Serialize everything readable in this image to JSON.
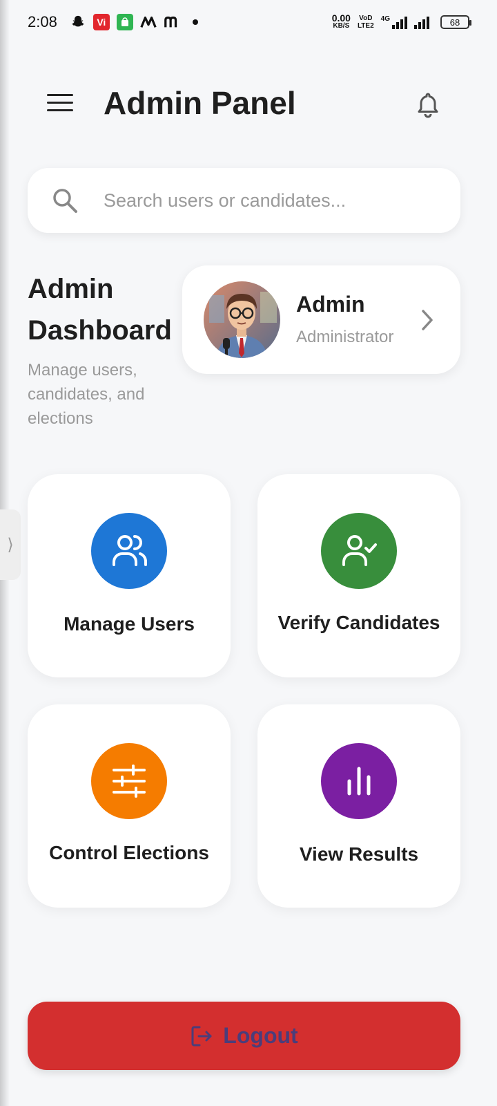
{
  "status_bar": {
    "time": "2:08",
    "net_speed_value": "0.00",
    "net_speed_unit": "KB/S",
    "volte_top": "VoD",
    "volte_bottom": "LTE2",
    "network_type": "4G",
    "battery": "68",
    "icons": [
      "snapchat-icon",
      "vi-icon",
      "android-store-icon",
      "m-icon",
      "m-icon"
    ]
  },
  "header": {
    "title": "Admin Panel"
  },
  "search": {
    "placeholder": "Search users or candidates..."
  },
  "dashboard": {
    "title": "Admin Dashboard",
    "subtitle": "Manage users, candidates, and elections"
  },
  "profile": {
    "name": "Admin",
    "role": "Administrator"
  },
  "tiles": [
    {
      "label": "Manage Users",
      "icon": "users-icon",
      "color": "#1e77d6"
    },
    {
      "label": "Verify Candidates",
      "icon": "user-check-icon",
      "color": "#388e3c"
    },
    {
      "label": "Control Elections",
      "icon": "sliders-icon",
      "color": "#f57c00"
    },
    {
      "label": "View Results",
      "icon": "bar-chart-icon",
      "color": "#7b1fa2"
    }
  ],
  "logout": {
    "label": "Logout",
    "color": "#d32f2f"
  },
  "colors": {
    "background": "#f6f7f9",
    "card": "#ffffff",
    "muted_text": "#9a9a9a"
  }
}
